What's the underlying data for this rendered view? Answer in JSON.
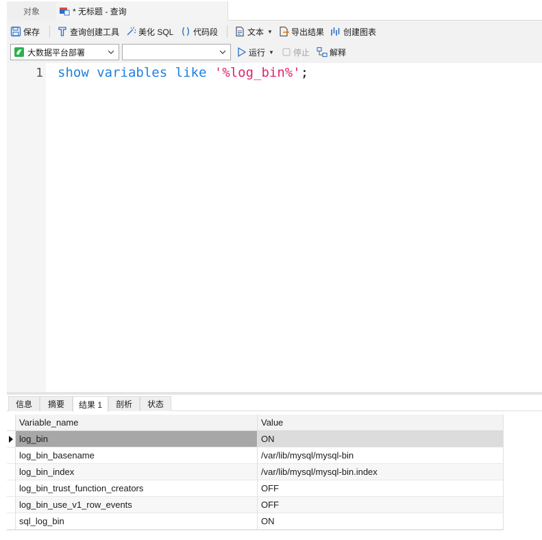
{
  "tabs": {
    "objects_label": "对象",
    "query_label": "* 无标题 - 查询"
  },
  "toolbar": {
    "save": "保存",
    "query_builder": "查询创建工具",
    "beautify": "美化 SQL",
    "snippet": "代码段",
    "text": "文本",
    "export": "导出结果",
    "create_chart": "创建图表",
    "connection": "大数据平台部署",
    "database": "",
    "run": "运行",
    "stop": "停止",
    "explain": "解释"
  },
  "editor": {
    "line_number": "1",
    "kw1": "show",
    "kw2": "variables",
    "kw3": "like",
    "string": "'%log_bin%'",
    "semicolon": ";"
  },
  "result_tabs": {
    "info": "信息",
    "summary": "摘要",
    "result1": "结果 1",
    "profile": "剖析",
    "status": "状态"
  },
  "grid": {
    "headers": [
      "Variable_name",
      "Value"
    ],
    "rows": [
      [
        "log_bin",
        "ON"
      ],
      [
        "log_bin_basename",
        "/var/lib/mysql/mysql-bin"
      ],
      [
        "log_bin_index",
        "/var/lib/mysql/mysql-bin.index"
      ],
      [
        "log_bin_trust_function_creators",
        "OFF"
      ],
      [
        "log_bin_use_v1_row_events",
        "OFF"
      ],
      [
        "sql_log_bin",
        "ON"
      ]
    ]
  },
  "colors": {
    "keyword": "#1e7fe0",
    "string": "#e0246d",
    "icon_blue": "#2a6fc9",
    "connection_green": "#2bb24c",
    "selected_row": "#a7a7a7"
  }
}
